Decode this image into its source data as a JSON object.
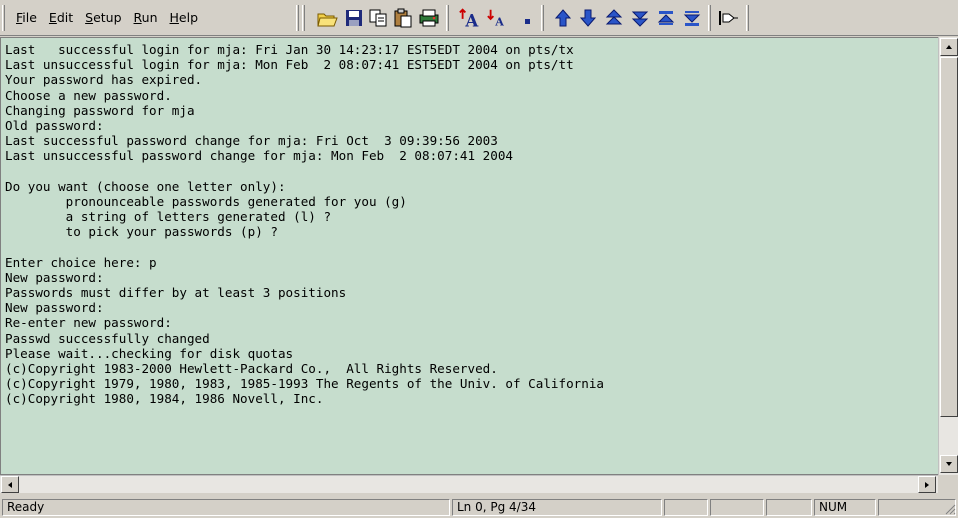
{
  "menu": [
    {
      "first": "F",
      "rest": "ile"
    },
    {
      "first": "E",
      "rest": "dit"
    },
    {
      "first": "S",
      "rest": "etup"
    },
    {
      "first": "R",
      "rest": "un"
    },
    {
      "first": "H",
      "rest": "elp"
    }
  ],
  "toolbar_icons": [
    "open-folder-icon",
    "save-icon",
    "copy-icon",
    "paste-icon",
    "print-icon",
    "font-larger-icon",
    "font-smaller-icon",
    "small-square-icon",
    "arrow-up-icon",
    "arrow-down-icon",
    "double-arrow-up-icon",
    "double-arrow-down-icon",
    "top-bar-icon",
    "bottom-bar-icon",
    "connect-icon"
  ],
  "terminal": {
    "lines": [
      "Last   successful login for mja: Fri Jan 30 14:23:17 EST5EDT 2004 on pts/tx",
      "Last unsuccessful login for mja: Mon Feb  2 08:07:41 EST5EDT 2004 on pts/tt",
      "Your password has expired.",
      "Choose a new password.",
      "Changing password for mja",
      "Old password:",
      "Last successful password change for mja: Fri Oct  3 09:39:56 2003",
      "Last unsuccessful password change for mja: Mon Feb  2 08:07:41 2004",
      "",
      "Do you want (choose one letter only):",
      "        pronounceable passwords generated for you (g)",
      "        a string of letters generated (l) ?",
      "        to pick your passwords (p) ?",
      "",
      "Enter choice here: p",
      "New password:",
      "Passwords must differ by at least 3 positions",
      "New password:",
      "Re-enter new password:",
      "Passwd successfully changed",
      "Please wait...checking for disk quotas",
      "(c)Copyright 1983-2000 Hewlett-Packard Co.,  All Rights Reserved.",
      "(c)Copyright 1979, 1980, 1983, 1985-1993 The Regents of the Univ. of California",
      "(c)Copyright 1980, 1984, 1986 Novell, Inc."
    ],
    "background": "#c6ddcd"
  },
  "status": {
    "text": "Ready",
    "position": "Ln 0, Pg 4/34",
    "empty1": "",
    "empty2": "",
    "empty3": "",
    "num": "NUM",
    "empty4": ""
  }
}
